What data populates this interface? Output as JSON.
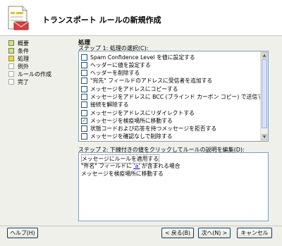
{
  "header": {
    "title": "トランスポート ルールの新規作成"
  },
  "steps": [
    {
      "label": "概要"
    },
    {
      "label": "条件"
    },
    {
      "label": "処理"
    },
    {
      "label": "例外"
    },
    {
      "label": "ルールの作成"
    },
    {
      "label": "完了"
    }
  ],
  "section_title": "処理",
  "step1_label": "ステップ 1: 処理の選択(C):",
  "actions": [
    {
      "label": "Spam Confidence Level を値に設定する",
      "checked": false
    },
    {
      "label": "ヘッダーに値を設定する",
      "checked": false
    },
    {
      "label": "ヘッダーを削除する",
      "checked": false
    },
    {
      "label": "\"宛先\" フィールドのアドレスに受信者を追加する",
      "checked": false
    },
    {
      "label": "メッセージをアドレスにコピーする",
      "checked": false
    },
    {
      "label": "メッセージをアドレスに BCC (ブラインド カーボン コピー) で送信する",
      "checked": false
    },
    {
      "label": "接続を解除する",
      "checked": false
    },
    {
      "label": "メッセージをアドレスにリダイレクトする",
      "checked": false
    },
    {
      "label": "メッセージを検疫場所に移動する",
      "checked": true
    },
    {
      "label": "状態コードおよび応答を持つメッセージを拒否する",
      "checked": false
    },
    {
      "label": "メッセージを確認なしで削除する",
      "checked": false
    }
  ],
  "step2_label": "ステップ 2: 下線付きの値をクリックしてルールの説明を編集(D):",
  "description": {
    "line1": "メッセージにルールを適用する",
    "line2_prefix": "\"件名\" フィールドに ",
    "line2_link": "'a'",
    "line2_suffix": " が含まれる場合",
    "line3": "メッセージを検疫場所に移動する"
  },
  "buttons": {
    "help": "ヘルプ(H)",
    "back": "< 戻る(B)",
    "next": "次へ(N) >",
    "cancel": "キャンセル"
  }
}
